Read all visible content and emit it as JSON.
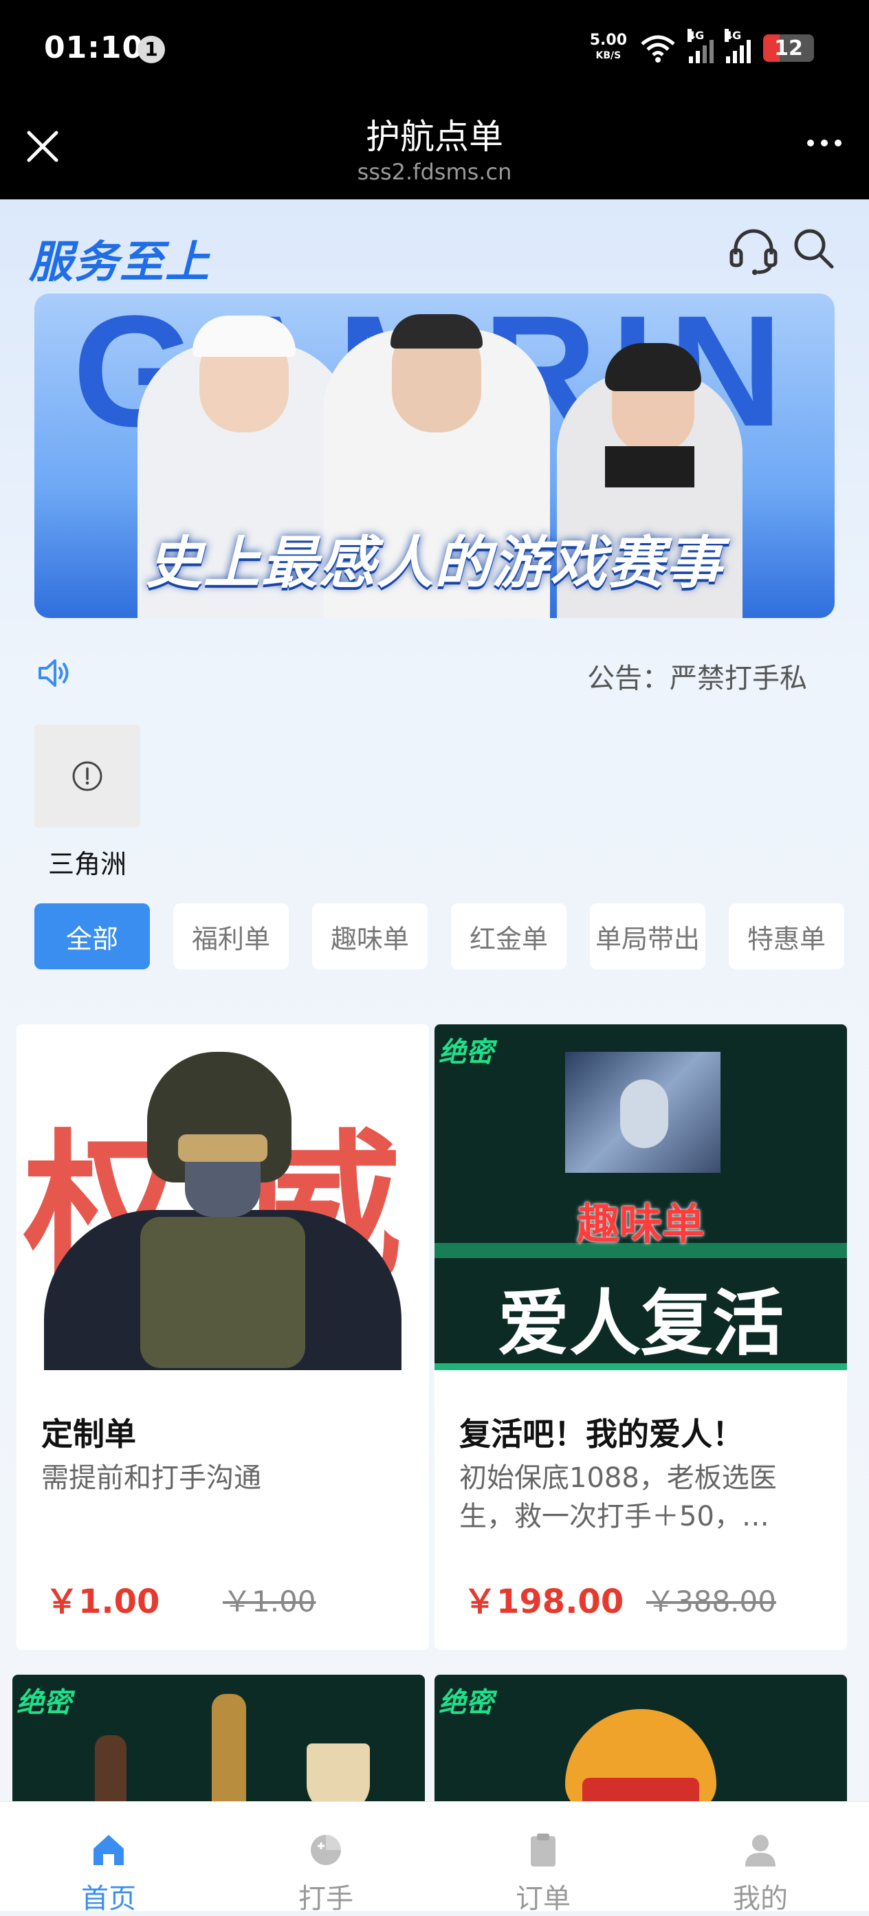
{
  "status_bar": {
    "time": "01:10",
    "notification_count": "1",
    "net_speed": "5.00",
    "net_unit": "KB/S",
    "sim1": "4G",
    "sim2": "4G",
    "battery": "12"
  },
  "title_bar": {
    "title": "护航点单",
    "url": "sss2.fdsms.cn"
  },
  "header": {
    "brand": "服务至上"
  },
  "banner": {
    "big_text": "GAMRIN",
    "caption": "史上最感人的游戏赛事"
  },
  "notice": {
    "text": "公告：严禁打手私"
  },
  "categories": [
    {
      "label": "三角洲"
    }
  ],
  "tabs": [
    {
      "label": "全部"
    },
    {
      "label": "福利单"
    },
    {
      "label": "趣味单"
    },
    {
      "label": "红金单"
    },
    {
      "label": "单局带出"
    },
    {
      "label": "特惠单"
    }
  ],
  "products": [
    {
      "title": "定制单",
      "desc": "需提前和打手沟通",
      "price": "￥1.00",
      "old_price": "￥1.00",
      "image_text": [
        "权",
        "威"
      ]
    },
    {
      "title": "复活吧！我的爱人！",
      "desc": "初始保底1088，老板选医生，救一次打手＋50，…",
      "price": "￥198.00",
      "old_price": "￥388.00",
      "image_badge": "绝密",
      "image_subtitle": "趣味单",
      "image_title": "爱人复活"
    },
    {
      "image_badge": "绝密"
    },
    {
      "image_badge": "绝密"
    }
  ],
  "bottom_nav": [
    {
      "label": "首页",
      "icon": "home-icon",
      "active": true
    },
    {
      "label": "打手",
      "icon": "gamepad-icon",
      "active": false
    },
    {
      "label": "订单",
      "icon": "clipboard-icon",
      "active": false
    },
    {
      "label": "我的",
      "icon": "user-icon",
      "active": false
    }
  ],
  "colors": {
    "accent": "#3a8ef0",
    "price": "#e63a2e",
    "brand": "#1f6ee8"
  }
}
